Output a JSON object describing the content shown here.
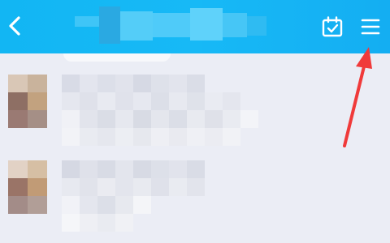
{
  "header": {
    "back_icon": "chevron-left-icon",
    "title": "",
    "calendar_icon": "calendar-check-icon",
    "menu_icon": "hamburger-menu-icon"
  },
  "colors": {
    "header_bg": "#17b9f6",
    "list_bg": "#ebedf5",
    "annotation_arrow": "#f03a3a"
  },
  "chats": [
    {
      "name": "",
      "preview": "",
      "avatar": "pixelated-avatar"
    },
    {
      "name": "",
      "preview": "",
      "avatar": "pixelated-avatar"
    }
  ]
}
